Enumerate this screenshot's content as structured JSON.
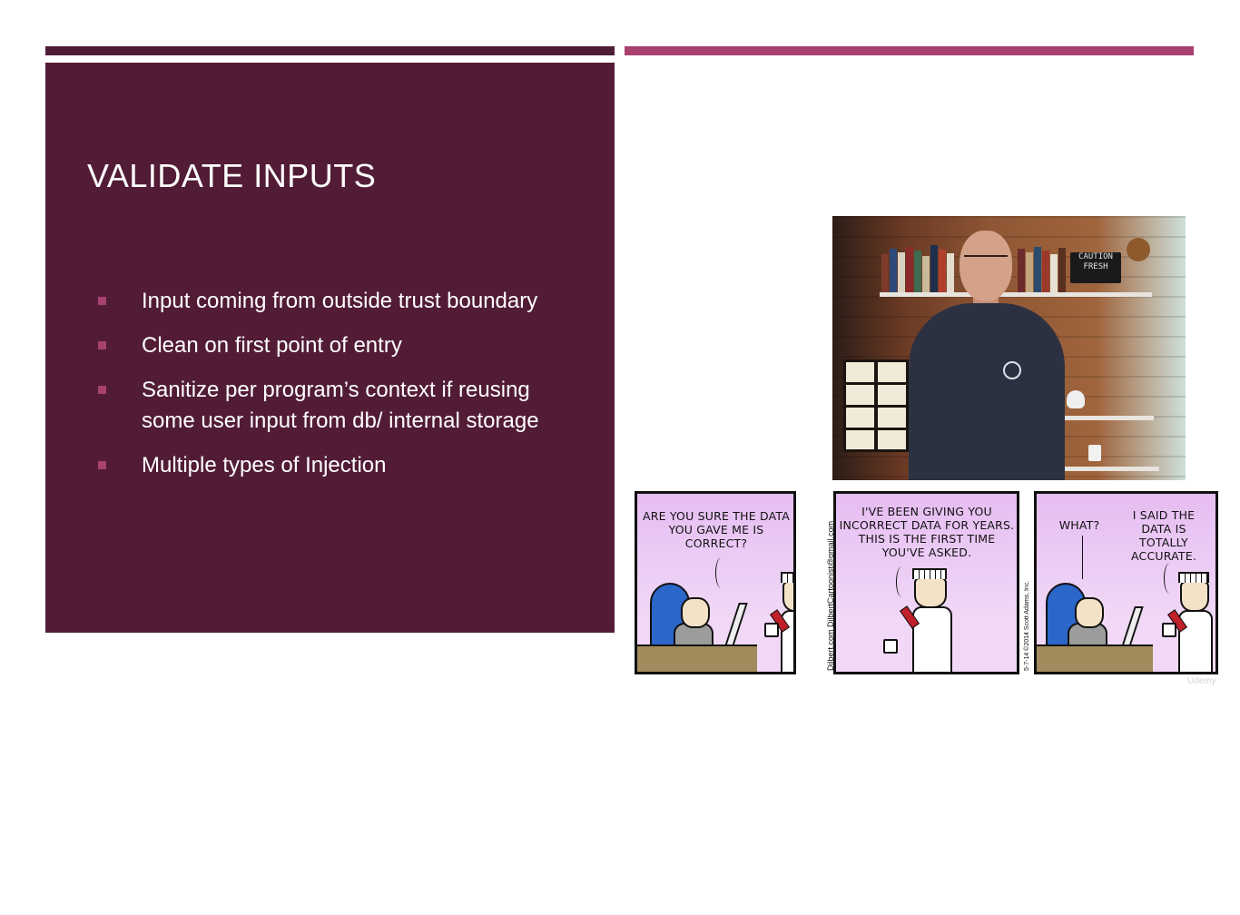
{
  "slide": {
    "title": "VALIDATE INPUTS",
    "bullets": [
      {
        "text": "Input coming from outside trust boundary"
      },
      {
        "text": "Clean on first point of entry"
      },
      {
        "text": "Sanitize per program’s context if reusing some user input from db/ internal storage"
      },
      {
        "text": "Multiple types of Injection"
      }
    ],
    "colors": {
      "panel": "#521c37",
      "accent": "#a8416f"
    }
  },
  "video": {
    "sign_line1": "CAUTION",
    "sign_line2": "FRESH"
  },
  "comic": {
    "panel1": "ARE YOU SURE THE DATA YOU GAVE ME IS CORRECT?",
    "panel2": "I'VE BEEN GIVING YOU INCORRECT DATA FOR YEARS. THIS IS THE FIRST TIME YOU'VE ASKED.",
    "panel3_left": "WHAT?",
    "panel3_right": "I SAID THE DATA IS TOTALLY ACCURATE.",
    "gutter1": "Dilbert.com   DilbertCartoonist@gmail.com",
    "gutter2": "5-7-14   ©2014 Scott Adams, Inc."
  },
  "watermark": "Udemy"
}
